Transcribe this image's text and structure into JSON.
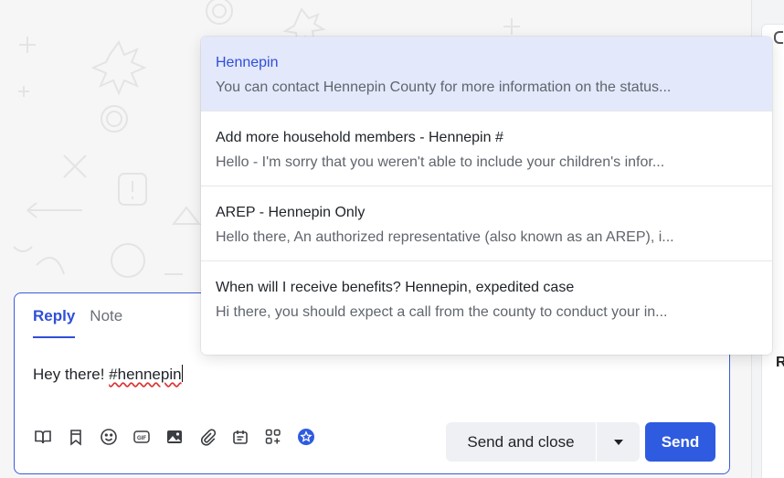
{
  "dropdown": {
    "items": [
      {
        "title": "Hennepin",
        "description": "You can contact Hennepin County for more information on the status..."
      },
      {
        "title": "Add more household members - Hennepin #",
        "description": "Hello - I'm sorry that you weren't able to include your children's infor..."
      },
      {
        "title": "AREP - Hennepin Only",
        "description": "Hello there, An authorized representative (also known as an AREP), i..."
      },
      {
        "title": "When will I receive benefits? Hennepin, expedited case",
        "description": "Hi there, you should expect a call from the county to conduct your in..."
      }
    ]
  },
  "composer": {
    "tabs": [
      {
        "label": "Reply",
        "active": true
      },
      {
        "label": "Note",
        "active": false
      }
    ],
    "message_prefix": "Hey there! ",
    "message_tag": "#hennepin",
    "toolbar_icons": [
      "book-icon",
      "bookmark-icon",
      "emoji-icon",
      "gif-icon",
      "image-icon",
      "attachment-icon",
      "article-icon",
      "apps-add-icon",
      "ai-star-icon"
    ],
    "send_close_label": "Send and close",
    "send_label": "Send"
  },
  "right_panel": {
    "peek_letter": "R"
  },
  "colors": {
    "accent": "#2f5be0",
    "selected_bg": "#e3e8fb",
    "border_focus": "#3b5bdb"
  }
}
